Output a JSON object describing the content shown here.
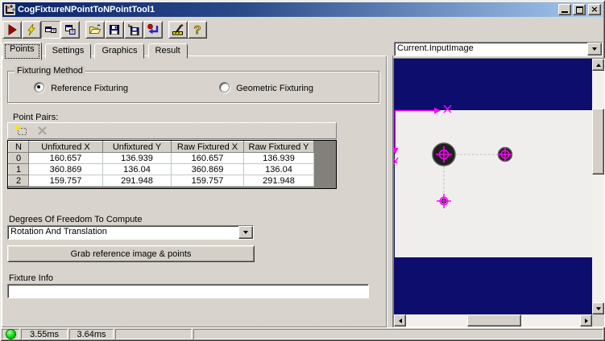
{
  "window": {
    "title": "CogFixtureNPointToNPointTool1"
  },
  "toolbar": {
    "buttons": [
      "run",
      "trigger",
      "show-tool-display",
      "float-window",
      "open-file",
      "save-file",
      "save-as",
      "reset-tool",
      "edit-tool",
      "help"
    ]
  },
  "tabs": {
    "items": [
      "Points",
      "Settings",
      "Graphics",
      "Result"
    ],
    "active": "Points"
  },
  "fixturing": {
    "label": "Fixturing Method",
    "options": [
      {
        "label": "Reference Fixturing",
        "selected": true
      },
      {
        "label": "Geometric Fixturing",
        "selected": false
      }
    ]
  },
  "point_pairs": {
    "label": "Point Pairs:",
    "columns": [
      "N",
      "Unfixtured X",
      "Unfixtured Y",
      "Raw Fixtured X",
      "Raw Fixtured Y"
    ],
    "rows": [
      [
        "0",
        "160.657",
        "136.939",
        "160.657",
        "136.939"
      ],
      [
        "1",
        "360.869",
        "136.04",
        "360.869",
        "136.04"
      ],
      [
        "2",
        "159.757",
        "291.948",
        "159.757",
        "291.948"
      ]
    ]
  },
  "dof": {
    "label": "Degrees Of Freedom To Compute",
    "value": "Rotation And Translation"
  },
  "buttons": {
    "grab": "Grab reference image & points"
  },
  "fixture_info": {
    "label": "Fixture Info",
    "value": ""
  },
  "display": {
    "source": "Current.InputImage",
    "axis_x_label": "X",
    "axis_y_label": "y"
  },
  "status": {
    "times": [
      "3.55ms",
      "3.64ms"
    ]
  },
  "colors": {
    "image_background": "#0d0d6e",
    "overlay_graphics": "#ff00ff",
    "titlebar_left": "#0a246a",
    "titlebar_right": "#a6caf0",
    "status_led": "#00d400"
  }
}
